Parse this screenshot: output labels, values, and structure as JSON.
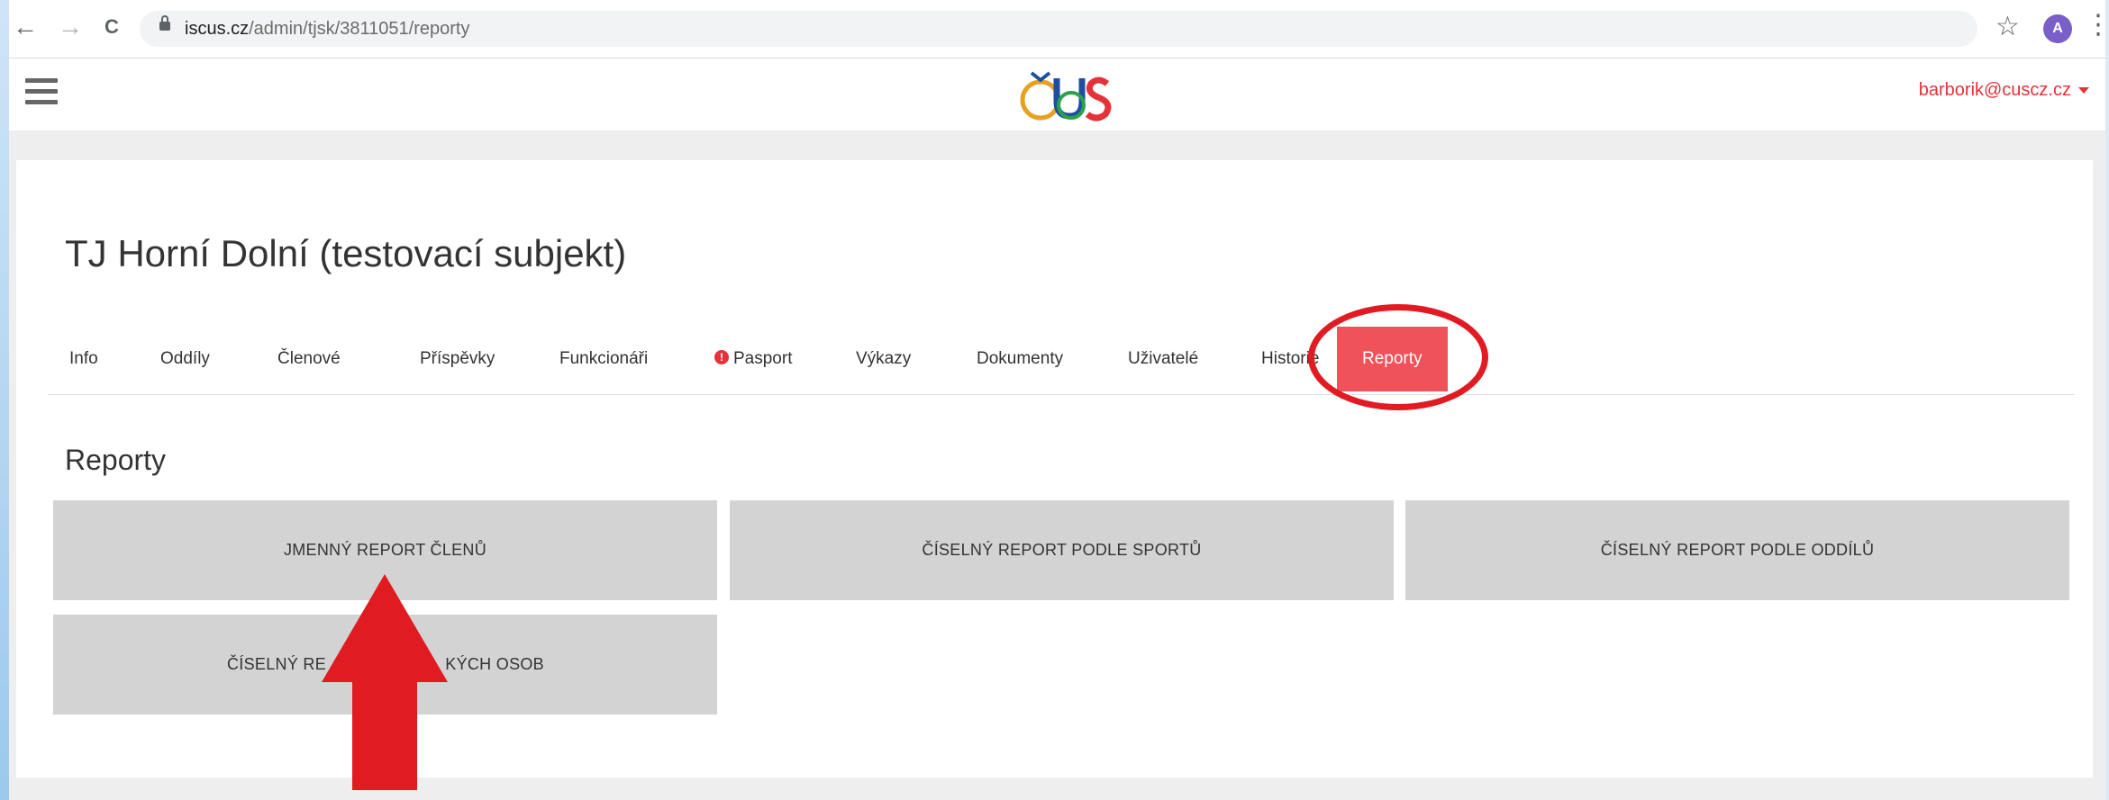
{
  "browser": {
    "url_domain": "iscus.cz",
    "url_path": "/admin/tjsk/3811051/reporty",
    "avatar_initial": "A",
    "back_icon": "←",
    "forward_icon": "→",
    "reload_icon": "C",
    "star_icon": "☆",
    "kebab_icon": "⋮"
  },
  "header": {
    "user_email": "barborik@cuscz.cz"
  },
  "entity": {
    "title": "TJ Horní Dolní (testovací subjekt)"
  },
  "tabs": [
    {
      "label": "Info"
    },
    {
      "label": "Oddíly"
    },
    {
      "label": "Členové"
    },
    {
      "label": "Příspěvky"
    },
    {
      "label": "Funkcionáři"
    },
    {
      "label": "Pasport",
      "icon": "warning-icon"
    },
    {
      "label": "Výkazy"
    },
    {
      "label": "Dokumenty"
    },
    {
      "label": "Uživatelé"
    },
    {
      "label": "Historie"
    },
    {
      "label": "Reporty",
      "active": true
    }
  ],
  "reports": {
    "title": "Reporty",
    "buttons": [
      {
        "label": "JMENNÝ REPORT ČLENŮ"
      },
      {
        "label": "ČÍSELNÝ REPORT PODLE SPORTŮ"
      },
      {
        "label": "ČÍSELNÝ REPORT PODLE ODDÍLŮ"
      },
      {
        "label_left": "ČÍSELNÝ RE",
        "label_right": "KÝCH OSOB"
      }
    ]
  },
  "colors": {
    "accent": "#f0525a",
    "annotation": "#e11b22",
    "button_bg": "#d3d3d3",
    "band_bg": "#eeeeee"
  }
}
